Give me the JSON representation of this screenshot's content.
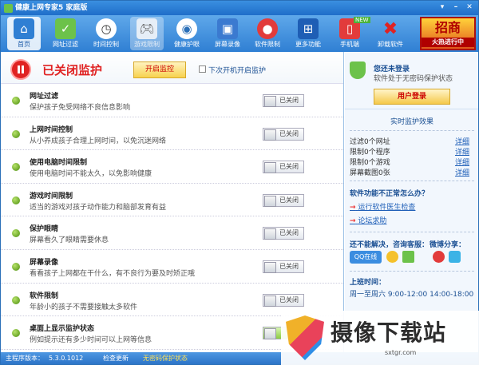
{
  "app": {
    "title": "健康上网专家5 家庭版"
  },
  "toolbar": {
    "items": [
      {
        "label": "首页",
        "icon": "home-icon"
      },
      {
        "label": "网址过滤",
        "icon": "filter-shield-icon"
      },
      {
        "label": "时间控制",
        "icon": "clock-icon"
      },
      {
        "label": "游戏限制",
        "icon": "gamepad-icon"
      },
      {
        "label": "健康护眼",
        "icon": "eye-icon"
      },
      {
        "label": "屏幕录像",
        "icon": "camera-icon"
      },
      {
        "label": "软件限制",
        "icon": "disc-icon"
      },
      {
        "label": "更多功能",
        "icon": "grid-icon"
      },
      {
        "label": "手机端",
        "icon": "phone-icon"
      },
      {
        "label": "卸载软件",
        "icon": "uninstall-icon"
      }
    ],
    "new_badge": "NEW"
  },
  "promo": {
    "title": "招商",
    "sub": "火热进行中"
  },
  "status": {
    "text": "已关闭监护",
    "start_button": "开启监控",
    "next_boot": "下次开机开启监护"
  },
  "features": [
    {
      "title": "网址过滤",
      "desc": "保护孩子免受网络不良信息影响",
      "switch": "已关闭"
    },
    {
      "title": "上网时间控制",
      "desc": "从小养成孩子合理上网时间，以免沉迷网络",
      "switch": "已关闭"
    },
    {
      "title": "使用电脑时间限制",
      "desc": "使用电脑时间不能太久，以免影响健康",
      "switch": "已关闭"
    },
    {
      "title": "游戏时间限制",
      "desc": "适当的游戏对孩子动作能力和脑部发育有益",
      "switch": "已关闭"
    },
    {
      "title": "保护眼睛",
      "desc": "屏幕看久了眼睛需要休息",
      "switch": "已关闭"
    },
    {
      "title": "屏幕录像",
      "desc": "看看孩子上网都在干什么，有不良行为要及时矫正哦",
      "switch": "已关闭"
    },
    {
      "title": "软件限制",
      "desc": "年龄小的孩子不需要接触太多软件",
      "switch": "已关闭"
    },
    {
      "title": "桌面上显示监护状态",
      "desc": "例如提示还有多少时间可以上网等信息",
      "switch": "已开"
    }
  ],
  "sidebar": {
    "login_title": "您还未登录",
    "login_sub": "软件处于无密码保护状态",
    "login_button": "用户登录",
    "effect_title": "实时监护效果",
    "effects": [
      {
        "label": "过滤0个网址",
        "link": "详细"
      },
      {
        "label": "限制0个程序",
        "link": "详细"
      },
      {
        "label": "限制0个游戏",
        "link": "详细"
      },
      {
        "label": "屏幕截图0张",
        "link": "详细"
      }
    ],
    "question": "软件功能不正常怎么办？",
    "links": [
      "运行软件医生检查",
      "论坛求助"
    ],
    "help_label": "还不能解决，咨询客服：",
    "share_label": "微博分享：",
    "qq": "QQ在线",
    "time_title": "上班时间：",
    "time_value": "周一至周六 9:00-12:00 14:00-18:00"
  },
  "statusbar": {
    "version_label": "主程序版本：",
    "version": "5.3.0.1012",
    "check_update": "检查更新",
    "protect": "无密码保护状态"
  },
  "watermark": {
    "text": "摄像下载站",
    "url": "sxtgr.com"
  }
}
